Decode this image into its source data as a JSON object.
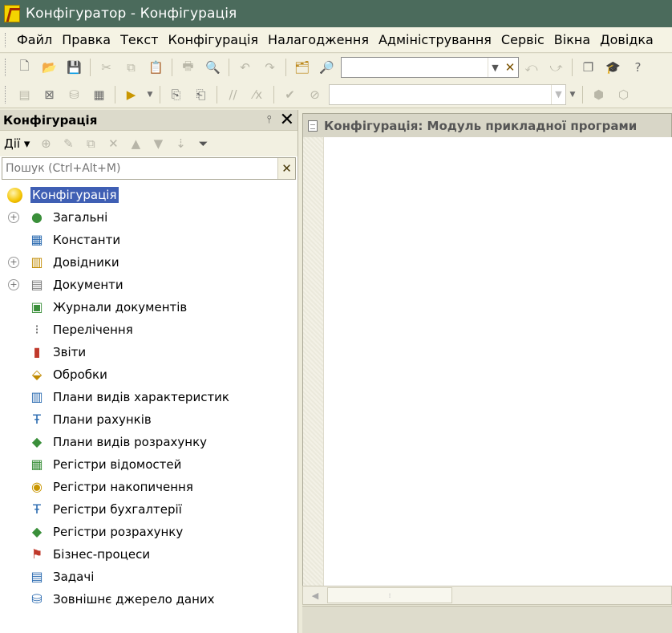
{
  "window": {
    "title": "Конфігуратор - Конфігурація"
  },
  "menu": [
    "Файл",
    "Правка",
    "Текст",
    "Конфігурація",
    "Налагодження",
    "Адміністрування",
    "Сервіс",
    "Вікна",
    "Довідка"
  ],
  "toolbar": {
    "search_value": "",
    "search2_value": ""
  },
  "left_panel": {
    "title": "Конфігурація",
    "actions_label": "Дії",
    "search_placeholder": "Пошук (Ctrl+Alt+M)",
    "root": "Конфігурація",
    "items": [
      {
        "label": "Загальні",
        "expandable": true,
        "icon": "common-icon"
      },
      {
        "label": "Константи",
        "expandable": false,
        "icon": "constants-icon"
      },
      {
        "label": "Довідники",
        "expandable": true,
        "icon": "catalogs-icon"
      },
      {
        "label": "Документи",
        "expandable": true,
        "icon": "documents-icon"
      },
      {
        "label": "Журнали документів",
        "expandable": false,
        "icon": "journals-icon"
      },
      {
        "label": "Перелічення",
        "expandable": false,
        "icon": "enums-icon"
      },
      {
        "label": "Звіти",
        "expandable": false,
        "icon": "reports-icon"
      },
      {
        "label": "Обробки",
        "expandable": false,
        "icon": "processing-icon"
      },
      {
        "label": "Плани видів характеристик",
        "expandable": false,
        "icon": "char-types-icon"
      },
      {
        "label": "Плани рахунків",
        "expandable": false,
        "icon": "chart-of-accounts-icon"
      },
      {
        "label": "Плани видів розрахунку",
        "expandable": false,
        "icon": "calc-types-icon"
      },
      {
        "label": "Регістри відомостей",
        "expandable": false,
        "icon": "info-registers-icon"
      },
      {
        "label": "Регістри накопичення",
        "expandable": false,
        "icon": "accum-registers-icon"
      },
      {
        "label": "Регістри бухгалтерії",
        "expandable": false,
        "icon": "accounting-registers-icon"
      },
      {
        "label": "Регістри розрахунку",
        "expandable": false,
        "icon": "calc-registers-icon"
      },
      {
        "label": "Бізнес-процеси",
        "expandable": false,
        "icon": "business-processes-icon"
      },
      {
        "label": "Задачі",
        "expandable": false,
        "icon": "tasks-icon"
      },
      {
        "label": "Зовнішнє джерело даних",
        "expandable": false,
        "icon": "external-data-source-icon"
      }
    ]
  },
  "document": {
    "tab_title": "Конфігурація: Модуль прикладної програми"
  }
}
